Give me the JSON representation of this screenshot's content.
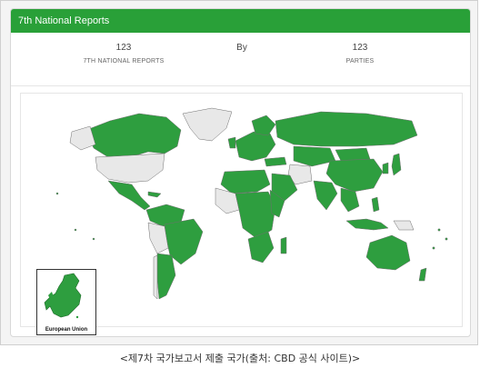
{
  "panel": {
    "title": "7th National Reports"
  },
  "stats": [
    {
      "value": "123",
      "label": "7TH NATIONAL REPORTS"
    },
    {
      "value": "By",
      "label": ""
    },
    {
      "value": "123",
      "label": "PARTIES"
    }
  ],
  "map": {
    "inset_label": "European Union",
    "colors": {
      "reported": "#2e9e3f",
      "not_reported": "#e8e8e8",
      "border": "#8a8a8a"
    }
  },
  "caption": "<제7차 국가보고서 제출 국가(출처: CBD 공식 사이트)>"
}
